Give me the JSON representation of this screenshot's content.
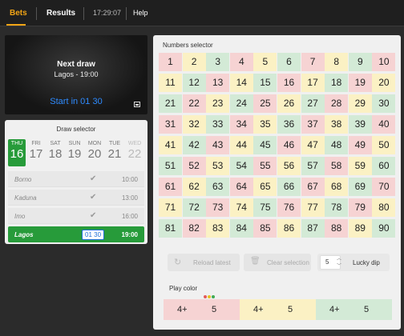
{
  "nav": {
    "bets": "Bets",
    "results": "Results",
    "time": "17:29:07",
    "help": "Help"
  },
  "video": {
    "title": "Next draw",
    "subtitle": "Lagos - 19:00",
    "start": "Start in 01 30"
  },
  "draw_selector": {
    "title": "Draw selector",
    "days": [
      {
        "name": "THU",
        "num": "16"
      },
      {
        "name": "FRI",
        "num": "17"
      },
      {
        "name": "SAT",
        "num": "18"
      },
      {
        "name": "SUN",
        "num": "19"
      },
      {
        "name": "MON",
        "num": "20"
      },
      {
        "name": "TUE",
        "num": "21"
      },
      {
        "name": "WED",
        "num": "22"
      }
    ],
    "draws": [
      {
        "name": "Borno",
        "time": "10:00"
      },
      {
        "name": "Kaduna",
        "time": "13:00"
      },
      {
        "name": "Imo",
        "time": "16:00"
      },
      {
        "name": "Lagos",
        "time": "19:00",
        "countdown": "01 30"
      }
    ]
  },
  "numbers": {
    "title": "Numbers selector",
    "values": [
      1,
      2,
      3,
      4,
      5,
      6,
      7,
      8,
      9,
      10,
      11,
      12,
      13,
      14,
      15,
      16,
      17,
      18,
      19,
      20,
      21,
      22,
      23,
      24,
      25,
      26,
      27,
      28,
      29,
      30,
      31,
      32,
      33,
      34,
      35,
      36,
      37,
      38,
      39,
      40,
      41,
      42,
      43,
      44,
      45,
      46,
      47,
      48,
      49,
      50,
      51,
      52,
      53,
      54,
      55,
      56,
      57,
      58,
      59,
      60,
      61,
      62,
      63,
      64,
      65,
      66,
      67,
      68,
      69,
      70,
      71,
      72,
      73,
      74,
      75,
      76,
      77,
      78,
      79,
      80,
      81,
      82,
      83,
      84,
      85,
      86,
      87,
      88,
      89,
      90
    ]
  },
  "controls": {
    "reload": "Reload latest",
    "clear": "Clear selection",
    "lucky_count": "5",
    "lucky": "Lucky dip"
  },
  "play_color": {
    "title": "Play color",
    "options": [
      {
        "a": "4+",
        "b": "5",
        "color": "#f6d3d3"
      },
      {
        "a": "4+",
        "b": "5",
        "color": "#fbf1c4"
      },
      {
        "a": "4+",
        "b": "5",
        "color": "#d3ead6"
      }
    ],
    "dot_colors": [
      "#e35a5a",
      "#e8c21f",
      "#3faa52"
    ]
  }
}
